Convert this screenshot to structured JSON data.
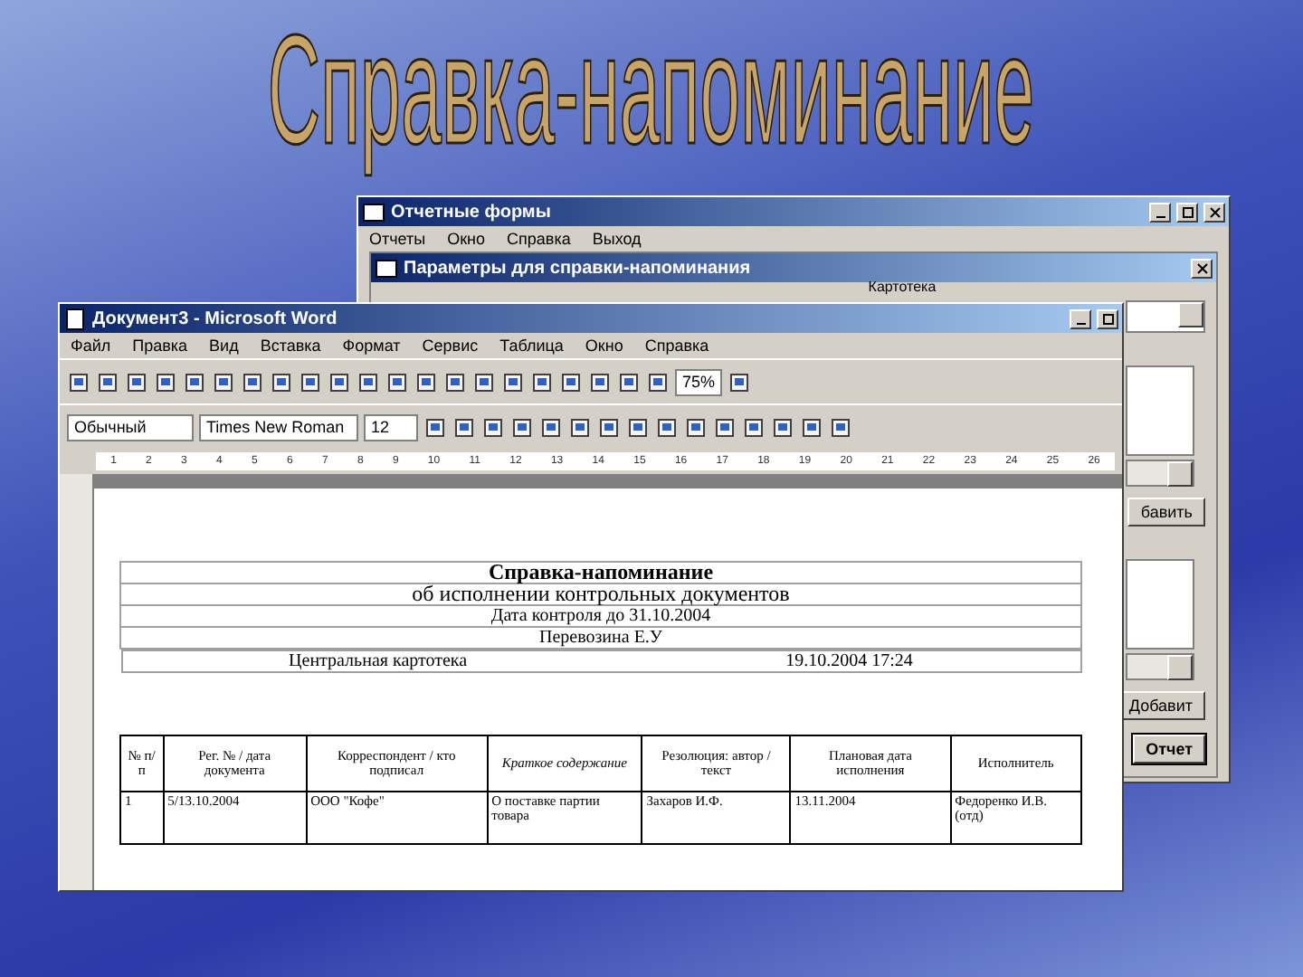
{
  "slide_title": "Справка-напоминание",
  "back_window": {
    "title": "Отчетные формы",
    "menu": [
      "Отчеты",
      "Окно",
      "Справка",
      "Выход"
    ],
    "dialog": {
      "title": "Параметры для справки-напоминания",
      "group_label": "Картотека",
      "buttons": [
        {
          "label": "бавить",
          "default": false
        },
        {
          "label": "Добавит",
          "default": false
        },
        {
          "label": "Отчет",
          "default": true
        }
      ]
    }
  },
  "word": {
    "title": "Документ3 - Microsoft Word",
    "menu": [
      "Файл",
      "Правка",
      "Вид",
      "Вставка",
      "Формат",
      "Сервис",
      "Таблица",
      "Окно",
      "Справка"
    ],
    "zoom": "75%",
    "style": "Обычный",
    "font": "Times New Roman",
    "size": "12",
    "ruler": [
      "1",
      "2",
      "3",
      "4",
      "5",
      "6",
      "7",
      "8",
      "9",
      "10",
      "11",
      "12",
      "13",
      "14",
      "15",
      "16",
      "17",
      "18",
      "19",
      "20",
      "21",
      "22",
      "23",
      "24",
      "25",
      "26"
    ],
    "document": {
      "title": "Справка-напоминание",
      "subtitle": "об исполнении контрольных документов",
      "lines": [
        "Дата контроля до 31.10.2004",
        "Перевозина Е.У"
      ],
      "footer_left": "Центральная картотека",
      "footer_right": "19.10.2004 17:24",
      "table": {
        "columns": [
          {
            "label": "№ п/п",
            "italic": false
          },
          {
            "label": "Рег. № / дата документа",
            "italic": false
          },
          {
            "label": "Корреспондент / кто подписал",
            "italic": false
          },
          {
            "label": "Краткое содержание",
            "italic": true
          },
          {
            "label": "Резолюция: автор / текст",
            "italic": false
          },
          {
            "label": "Плановая дата исполнения",
            "italic": false
          },
          {
            "label": "Исполнитель",
            "italic": false
          }
        ],
        "rows": [
          [
            "1",
            "5/13.10.2004",
            "ООО \"Кофе\"",
            "О поставке партии товара",
            "Захаров И.Ф.",
            "13.11.2004",
            "Федоренко И.В. (отд)"
          ]
        ]
      }
    }
  }
}
